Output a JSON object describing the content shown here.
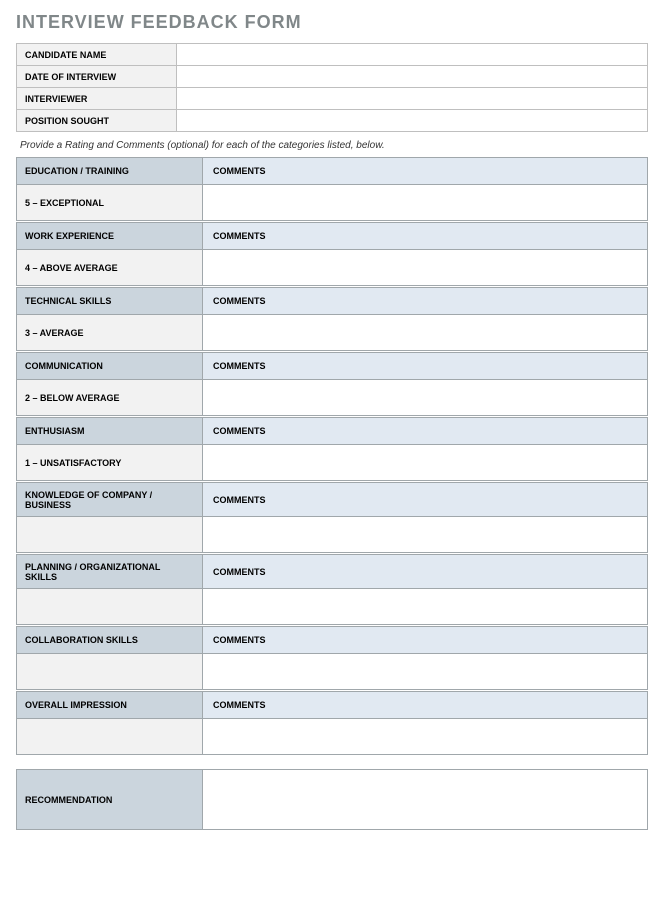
{
  "title": "INTERVIEW FEEDBACK FORM",
  "info": {
    "candidate_name_label": "CANDIDATE NAME",
    "candidate_name_value": "",
    "interview_date_label": "DATE OF INTERVIEW",
    "interview_date_value": "",
    "interviewer_label": "INTERVIEWER",
    "interviewer_value": "",
    "position_label": "POSITION SOUGHT",
    "position_value": ""
  },
  "instruction": "Provide a Rating and Comments (optional) for each of the categories listed, below.",
  "comments_label": "COMMENTS",
  "categories": [
    {
      "name": "EDUCATION / TRAINING",
      "rating": "5 – EXCEPTIONAL",
      "comments": ""
    },
    {
      "name": "WORK EXPERIENCE",
      "rating": "4 – ABOVE AVERAGE",
      "comments": ""
    },
    {
      "name": "TECHNICAL SKILLS",
      "rating": "3 – AVERAGE",
      "comments": ""
    },
    {
      "name": "COMMUNICATION",
      "rating": "2 – BELOW AVERAGE",
      "comments": ""
    },
    {
      "name": "ENTHUSIASM",
      "rating": "1 – UNSATISFACTORY",
      "comments": ""
    },
    {
      "name": "KNOWLEDGE OF COMPANY / BUSINESS",
      "rating": "",
      "comments": ""
    },
    {
      "name": "PLANNING / ORGANIZATIONAL SKILLS",
      "rating": "",
      "comments": ""
    },
    {
      "name": "COLLABORATION SKILLS",
      "rating": "",
      "comments": ""
    },
    {
      "name": "OVERALL IMPRESSION",
      "rating": "",
      "comments": ""
    }
  ],
  "recommendation": {
    "label": "RECOMMENDATION",
    "value": ""
  }
}
